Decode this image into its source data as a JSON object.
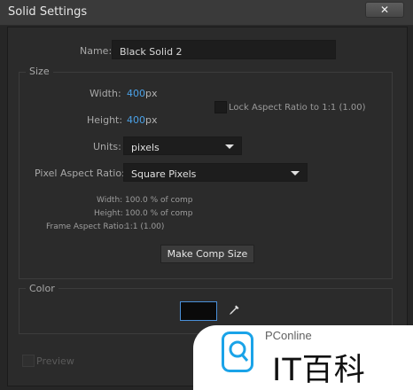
{
  "window": {
    "title": "Solid Settings",
    "close_glyph": "✕"
  },
  "name_field": {
    "label": "Name:",
    "value": "Black Solid 2"
  },
  "size": {
    "legend": "Size",
    "width_label": "Width:",
    "width_value": "400",
    "width_unit": "px",
    "height_label": "Height:",
    "height_value": "400",
    "height_unit": "px",
    "lock_label": "Lock Aspect Ratio to 1:1 (1.00)",
    "units_label": "Units:",
    "units_value": "pixels",
    "par_label": "Pixel Aspect Ratio:",
    "par_value": "Square Pixels",
    "info": [
      {
        "label": "Width:",
        "value": "100.0 % of comp"
      },
      {
        "label": "Height:",
        "value": "100.0 % of comp"
      },
      {
        "label": "Frame Aspect Ratio:",
        "value": "1:1 (1.00)"
      }
    ],
    "make_comp_size": "Make Comp Size"
  },
  "color": {
    "legend": "Color",
    "swatch_color": "#0a0a0a"
  },
  "preview_label": "Preview",
  "watermark": {
    "brand": "PConline",
    "text": "IT百科",
    "accent": "#1aa3e8"
  }
}
